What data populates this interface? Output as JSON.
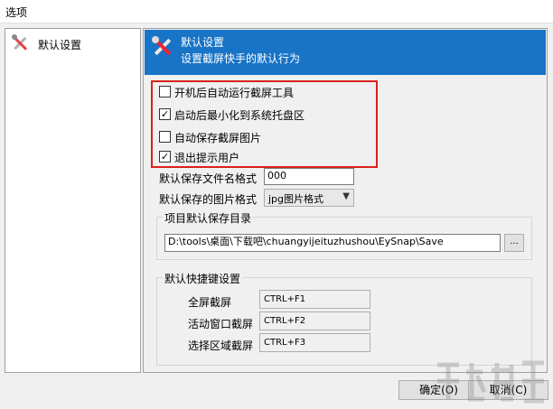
{
  "window": {
    "title": "选项"
  },
  "nav": {
    "items": [
      {
        "label": "默认设置",
        "icon": "tools-icon"
      }
    ]
  },
  "banner": {
    "title": "默认设置",
    "subtitle": "设置截屏快手的默认行为",
    "color": "#1874c6"
  },
  "options": [
    {
      "label": "开机后自动运行截屏工具",
      "checked": false
    },
    {
      "label": "启动后最小化到系统托盘区",
      "checked": true
    },
    {
      "label": "自动保存截屏图片",
      "checked": false
    },
    {
      "label": "退出提示用户",
      "checked": true
    }
  ],
  "highlight_color": "#d9221b",
  "filename": {
    "label": "默认保存文件名格式",
    "value": "000"
  },
  "image_format": {
    "label": "默认保存的图片格式",
    "value": "jpg图片格式"
  },
  "save_dir": {
    "legend": "项目默认保存目录",
    "value": "D:\\tools\\桌面\\下载吧\\chuangyijeituzhushou\\EySnap\\Save",
    "browse_label": "..."
  },
  "hotkeys": {
    "legend": "默认快捷键设置",
    "items": [
      {
        "label": "全屏截屏",
        "value": "CTRL+F1"
      },
      {
        "label": "活动窗口截屏",
        "value": "CTRL+F2"
      },
      {
        "label": "选择区域截屏",
        "value": "CTRL+F3"
      }
    ]
  },
  "buttons": {
    "ok": "确定(O)",
    "cancel": "取消(C)"
  }
}
